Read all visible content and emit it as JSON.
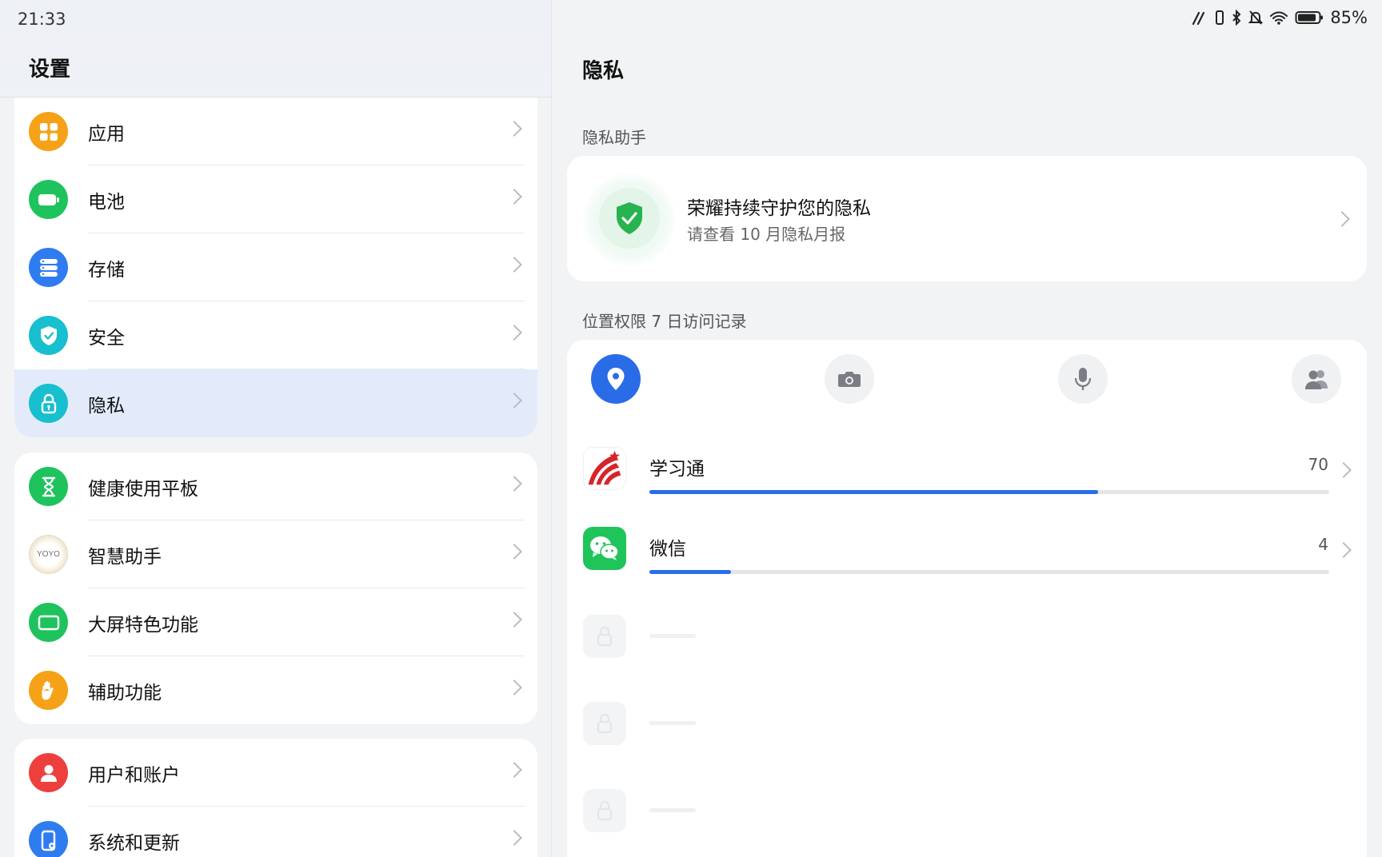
{
  "status_bar": {
    "time": "21:33",
    "battery": "85%"
  },
  "left": {
    "title": "设置",
    "group1": [
      {
        "label": "应用",
        "icon": "apps-icon",
        "color": "#f5a218"
      },
      {
        "label": "电池",
        "icon": "battery-icon",
        "color": "#1fc35e"
      },
      {
        "label": "存储",
        "icon": "storage-icon",
        "color": "#2f7cf0"
      },
      {
        "label": "安全",
        "icon": "security-shield-icon",
        "color": "#17bfcf"
      },
      {
        "label": "隐私",
        "icon": "privacy-lock-icon",
        "color": "#17bfcf",
        "selected": true
      }
    ],
    "group2": [
      {
        "label": "健康使用平板",
        "icon": "hourglass-icon",
        "color": "#1fc35e"
      },
      {
        "label": "智慧助手",
        "icon": "yoyo-icon",
        "color": "#f3efe2"
      },
      {
        "label": "大屏特色功能",
        "icon": "tablet-screen-icon",
        "color": "#1fc35e"
      },
      {
        "label": "辅助功能",
        "icon": "hand-icon",
        "color": "#f5a218"
      }
    ],
    "group3": [
      {
        "label": "用户和账户",
        "icon": "user-icon",
        "color": "#ee3f3f"
      },
      {
        "label": "系统和更新",
        "icon": "system-update-icon",
        "color": "#2f7cf0"
      }
    ],
    "yoyo_text": "YOYO"
  },
  "right": {
    "title": "隐私",
    "assistant_section": "隐私助手",
    "assistant_title": "荣耀持续守护您的隐私",
    "assistant_subtitle": "请查看 10 月隐私月报",
    "records_section": "位置权限 7 日访问记录",
    "permission_tabs": [
      {
        "icon": "location-icon",
        "active": true
      },
      {
        "icon": "camera-icon",
        "active": false
      },
      {
        "icon": "microphone-icon",
        "active": false
      },
      {
        "icon": "contacts-icon",
        "active": false
      }
    ],
    "apps": [
      {
        "name": "学习通",
        "count": "70",
        "fraction": 0.66,
        "icon": "xuexitong-icon"
      },
      {
        "name": "微信",
        "count": "4",
        "fraction": 0.12,
        "icon": "wechat-icon"
      }
    ]
  },
  "colors": {
    "accent": "#2a6ce8",
    "selected_row": "#e3ebfa"
  }
}
